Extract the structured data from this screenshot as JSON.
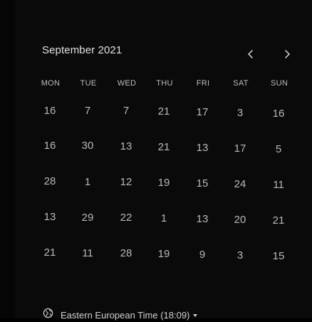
{
  "calendar": {
    "month_label": "September 2021",
    "weekdays": [
      "MON",
      "TUE",
      "WED",
      "THU",
      "FRI",
      "SAT",
      "SUN"
    ],
    "weeks": [
      [
        "16",
        "7",
        "7",
        "21",
        "17",
        "3",
        "16"
      ],
      [
        "16",
        "30",
        "13",
        "21",
        "13",
        "17",
        "5"
      ],
      [
        "28",
        "1",
        "12",
        "19",
        "15",
        "24",
        "11"
      ],
      [
        "13",
        "29",
        "22",
        "1",
        "13",
        "20",
        "21"
      ],
      [
        "21",
        "11",
        "28",
        "19",
        "9",
        "3",
        "15"
      ]
    ]
  },
  "navigation": {
    "prev_icon": "chevron-left-icon",
    "next_icon": "chevron-right-icon"
  },
  "timezone": {
    "label": "Eastern European Time (18:09)",
    "icon": "globe-icon"
  },
  "colors": {
    "background": "#0a0a0a",
    "text_primary": "#e2e2e2",
    "text_secondary": "#b8b8b8"
  }
}
